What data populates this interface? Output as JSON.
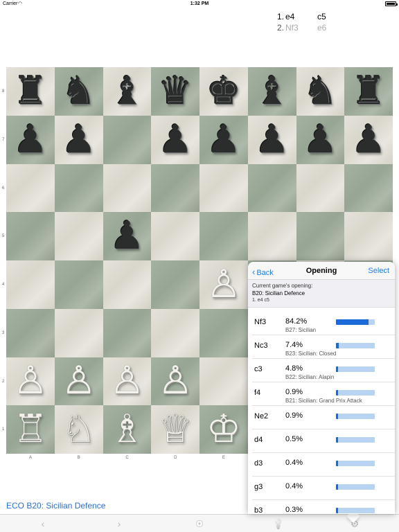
{
  "status": {
    "carrier": "Carrier",
    "time": "1:32 PM"
  },
  "moves": [
    {
      "num": "1.",
      "white": "e4",
      "black": "c5"
    },
    {
      "num": "2.",
      "white": "Nf3",
      "black": "e6"
    }
  ],
  "ranks": [
    "8",
    "7",
    "6",
    "5",
    "4",
    "3",
    "2",
    "1"
  ],
  "files": [
    "A",
    "B",
    "C",
    "D",
    "E"
  ],
  "board": [
    [
      {
        "p": "♜",
        "c": "black",
        "n": "black-rook-icon"
      },
      {
        "p": "♞",
        "c": "black",
        "n": "black-knight-icon"
      },
      {
        "p": "♝",
        "c": "black",
        "n": "black-bishop-icon"
      },
      {
        "p": "♛",
        "c": "black",
        "n": "black-queen-icon"
      },
      {
        "p": "♚",
        "c": "black",
        "n": "black-king-icon"
      },
      {
        "p": "♝",
        "c": "black",
        "n": "black-bishop-icon"
      },
      {
        "p": "♞",
        "c": "black",
        "n": "black-knight-icon"
      },
      {
        "p": "♜",
        "c": "black",
        "n": "black-rook-icon"
      }
    ],
    [
      {
        "p": "♟",
        "c": "black",
        "n": "black-pawn-icon"
      },
      {
        "p": "♟",
        "c": "black",
        "n": "black-pawn-icon"
      },
      {
        "p": "",
        "c": "",
        "n": ""
      },
      {
        "p": "♟",
        "c": "black",
        "n": "black-pawn-icon"
      },
      {
        "p": "♟",
        "c": "black",
        "n": "black-pawn-icon"
      },
      {
        "p": "♟",
        "c": "black",
        "n": "black-pawn-icon"
      },
      {
        "p": "♟",
        "c": "black",
        "n": "black-pawn-icon"
      },
      {
        "p": "♟",
        "c": "black",
        "n": "black-pawn-icon"
      }
    ],
    [
      {
        "p": "",
        "c": "",
        "n": ""
      },
      {
        "p": "",
        "c": "",
        "n": ""
      },
      {
        "p": "",
        "c": "",
        "n": ""
      },
      {
        "p": "",
        "c": "",
        "n": ""
      },
      {
        "p": "",
        "c": "",
        "n": ""
      },
      {
        "p": "",
        "c": "",
        "n": ""
      },
      {
        "p": "",
        "c": "",
        "n": ""
      },
      {
        "p": "",
        "c": "",
        "n": ""
      }
    ],
    [
      {
        "p": "",
        "c": "",
        "n": ""
      },
      {
        "p": "",
        "c": "",
        "n": ""
      },
      {
        "p": "♟",
        "c": "black",
        "n": "black-pawn-icon"
      },
      {
        "p": "",
        "c": "",
        "n": ""
      },
      {
        "p": "",
        "c": "",
        "n": ""
      },
      {
        "p": "",
        "c": "",
        "n": ""
      },
      {
        "p": "",
        "c": "",
        "n": ""
      },
      {
        "p": "",
        "c": "",
        "n": ""
      }
    ],
    [
      {
        "p": "",
        "c": "",
        "n": ""
      },
      {
        "p": "",
        "c": "",
        "n": ""
      },
      {
        "p": "",
        "c": "",
        "n": ""
      },
      {
        "p": "",
        "c": "",
        "n": ""
      },
      {
        "p": "♙",
        "c": "white",
        "n": "white-pawn-icon"
      },
      {
        "p": "",
        "c": "",
        "n": ""
      },
      {
        "p": "",
        "c": "",
        "n": ""
      },
      {
        "p": "",
        "c": "",
        "n": ""
      }
    ],
    [
      {
        "p": "",
        "c": "",
        "n": ""
      },
      {
        "p": "",
        "c": "",
        "n": ""
      },
      {
        "p": "",
        "c": "",
        "n": ""
      },
      {
        "p": "",
        "c": "",
        "n": ""
      },
      {
        "p": "",
        "c": "",
        "n": ""
      },
      {
        "p": "",
        "c": "",
        "n": ""
      },
      {
        "p": "",
        "c": "",
        "n": ""
      },
      {
        "p": "",
        "c": "",
        "n": ""
      }
    ],
    [
      {
        "p": "♙",
        "c": "white",
        "n": "white-pawn-icon"
      },
      {
        "p": "♙",
        "c": "white",
        "n": "white-pawn-icon"
      },
      {
        "p": "♙",
        "c": "white",
        "n": "white-pawn-icon"
      },
      {
        "p": "♙",
        "c": "white",
        "n": "white-pawn-icon"
      },
      {
        "p": "",
        "c": "",
        "n": ""
      },
      {
        "p": "",
        "c": "",
        "n": ""
      },
      {
        "p": "",
        "c": "",
        "n": ""
      },
      {
        "p": "",
        "c": "",
        "n": ""
      }
    ],
    [
      {
        "p": "♖",
        "c": "white",
        "n": "white-rook-icon"
      },
      {
        "p": "♘",
        "c": "white",
        "n": "white-knight-icon"
      },
      {
        "p": "♗",
        "c": "white",
        "n": "white-bishop-icon"
      },
      {
        "p": "♕",
        "c": "white",
        "n": "white-queen-icon"
      },
      {
        "p": "♔",
        "c": "white",
        "n": "white-king-icon"
      },
      {
        "p": "",
        "c": "",
        "n": ""
      },
      {
        "p": "",
        "c": "",
        "n": ""
      },
      {
        "p": "",
        "c": "",
        "n": ""
      }
    ]
  ],
  "eco": "ECO B20: Sicilian Defence",
  "popover": {
    "back_label": "Back",
    "title": "Opening",
    "select_label": "Select",
    "current_label": "Current game's opening:",
    "current_opening": "B20: Sicilian Defence",
    "current_moves": "1. e4 c5",
    "rows": [
      {
        "move": "Nf3",
        "pct": "84.2%",
        "name": "B27: Sicilian",
        "fraction": 0.842
      },
      {
        "move": "Nc3",
        "pct": "7.4%",
        "name": "B23: Sicilian: Closed",
        "fraction": 0.074
      },
      {
        "move": "c3",
        "pct": "4.8%",
        "name": "B22: Sicilian: Alapin",
        "fraction": 0.048
      },
      {
        "move": "f4",
        "pct": "0.9%",
        "name": "B21: Sicilian: Grand Prix Attack",
        "fraction": 0.009
      },
      {
        "move": "Ne2",
        "pct": "0.9%",
        "name": "",
        "fraction": 0.009
      },
      {
        "move": "d4",
        "pct": "0.5%",
        "name": "",
        "fraction": 0.005
      },
      {
        "move": "d3",
        "pct": "0.4%",
        "name": "",
        "fraction": 0.004
      },
      {
        "move": "g3",
        "pct": "0.4%",
        "name": "",
        "fraction": 0.004
      },
      {
        "move": "b3",
        "pct": "0.3%",
        "name": "",
        "fraction": 0.003
      }
    ]
  },
  "toolbar": {
    "back_icon": "‹",
    "forward_icon": "›",
    "hint_icon": "☉",
    "bulb_icon": "💡",
    "gear_icon": "⚙"
  },
  "colors": {
    "accent": "#1f7cf2",
    "bar_fill": "#1a6ad8",
    "bar_bg": "#b9d4f3",
    "eco_link": "#2a6ed8"
  }
}
